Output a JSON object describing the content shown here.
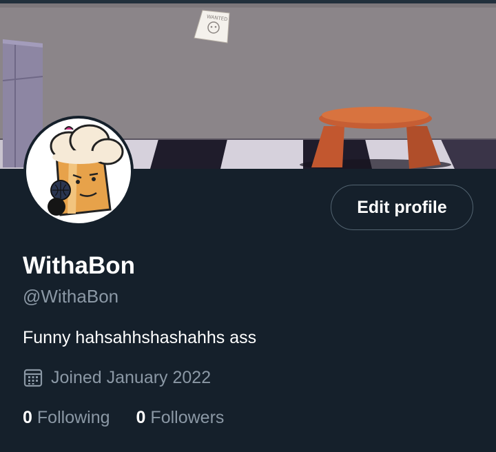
{
  "profile": {
    "display_name": "WithaBon",
    "handle": "@WithaBon",
    "bio": "Funny hahsahhshashahhs ass",
    "joined": "Joined January 2022",
    "edit_button": "Edit profile",
    "banner_sign_text": "WANTED"
  },
  "stats": {
    "following_count": "0",
    "following_label": "Following",
    "followers_count": "0",
    "followers_label": "Followers"
  },
  "colors": {
    "background": "#15202b",
    "secondary_text": "#8b98a5",
    "button_border": "#536471"
  },
  "icons": {
    "joined": "calendar-icon"
  }
}
